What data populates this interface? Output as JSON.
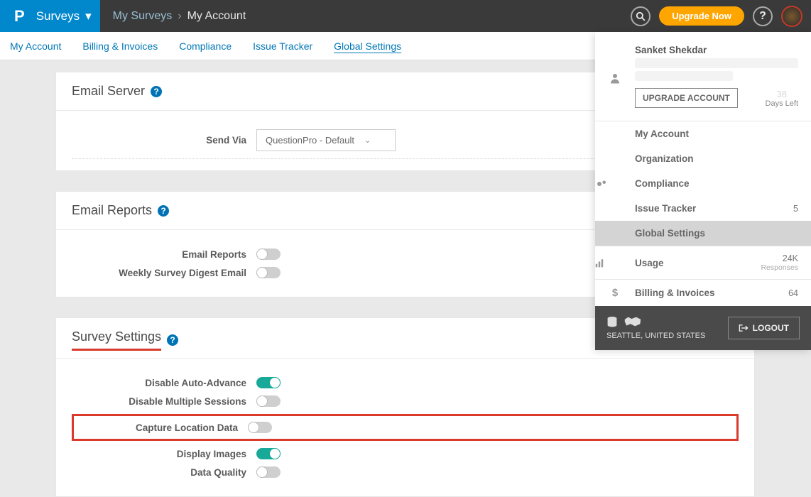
{
  "header": {
    "brand_app": "Surveys",
    "breadcrumb": [
      "My Surveys",
      "My Account"
    ],
    "upgrade_label": "Upgrade Now"
  },
  "subnav": {
    "items": [
      {
        "label": "My Account",
        "active": false
      },
      {
        "label": "Billing & Invoices",
        "active": false
      },
      {
        "label": "Compliance",
        "active": false
      },
      {
        "label": "Issue Tracker",
        "active": false
      },
      {
        "label": "Global Settings",
        "active": true
      }
    ]
  },
  "cards": {
    "email_server": {
      "title": "Email Server",
      "send_via_label": "Send Via",
      "send_via_value": "QuestionPro - Default"
    },
    "email_reports": {
      "title": "Email Reports",
      "rows": [
        {
          "label": "Email Reports",
          "on": false
        },
        {
          "label": "Weekly Survey Digest Email",
          "on": false
        }
      ]
    },
    "survey_settings": {
      "title": "Survey Settings",
      "rows": [
        {
          "label": "Disable Auto-Advance",
          "on": true,
          "callout": false
        },
        {
          "label": "Disable Multiple Sessions",
          "on": false,
          "callout": false
        },
        {
          "label": "Capture Location Data",
          "on": false,
          "callout": true
        },
        {
          "label": "Display Images",
          "on": true,
          "callout": false
        },
        {
          "label": "Data Quality",
          "on": false,
          "callout": false
        }
      ]
    }
  },
  "user_panel": {
    "name": "Sanket Shekdar",
    "days_left_value": "38",
    "days_left_label": "Days Left",
    "upgrade_account_label": "UPGRADE ACCOUNT",
    "menu": [
      {
        "icon": "",
        "label": "My Account",
        "value": "",
        "sub": ""
      },
      {
        "icon": "",
        "label": "Organization",
        "value": "",
        "sub": ""
      },
      {
        "icon": "gears",
        "label": "Compliance",
        "value": "",
        "sub": ""
      },
      {
        "icon": "",
        "label": "Issue Tracker",
        "value": "5",
        "sub": ""
      },
      {
        "icon": "",
        "label": "Global Settings",
        "value": "",
        "sub": "",
        "active": true
      },
      {
        "icon": "bars",
        "label": "Usage",
        "value": "24K",
        "sub": "Responses"
      },
      {
        "icon": "dollar",
        "label": "Billing & Invoices",
        "value": "64",
        "sub": ""
      }
    ],
    "location": "SEATTLE, UNITED STATES",
    "logout_label": "LOGOUT"
  }
}
